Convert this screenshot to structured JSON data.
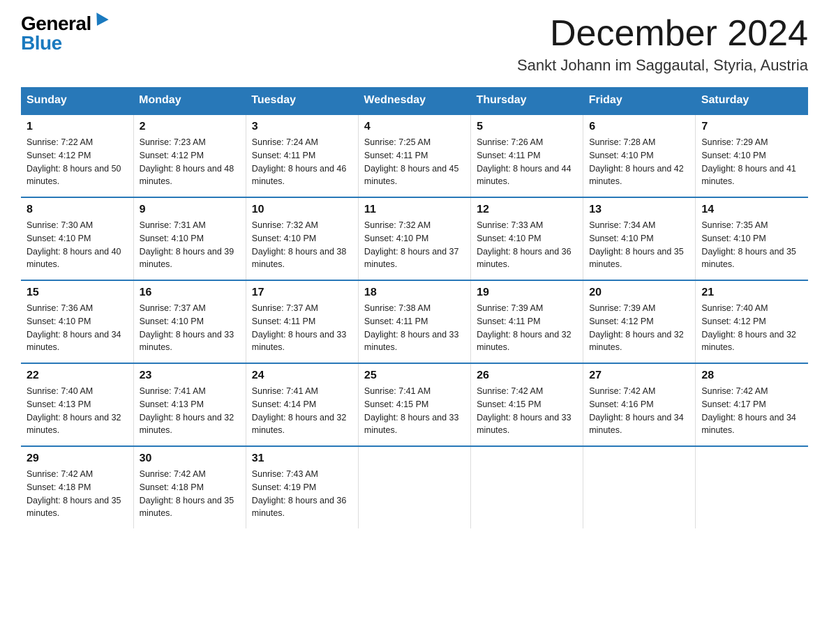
{
  "logo": {
    "general": "General",
    "blue": "Blue"
  },
  "header": {
    "month": "December 2024",
    "location": "Sankt Johann im Saggautal, Styria, Austria"
  },
  "weekdays": [
    "Sunday",
    "Monday",
    "Tuesday",
    "Wednesday",
    "Thursday",
    "Friday",
    "Saturday"
  ],
  "weeks": [
    [
      {
        "day": "1",
        "sunrise": "7:22 AM",
        "sunset": "4:12 PM",
        "daylight": "8 hours and 50 minutes."
      },
      {
        "day": "2",
        "sunrise": "7:23 AM",
        "sunset": "4:12 PM",
        "daylight": "8 hours and 48 minutes."
      },
      {
        "day": "3",
        "sunrise": "7:24 AM",
        "sunset": "4:11 PM",
        "daylight": "8 hours and 46 minutes."
      },
      {
        "day": "4",
        "sunrise": "7:25 AM",
        "sunset": "4:11 PM",
        "daylight": "8 hours and 45 minutes."
      },
      {
        "day": "5",
        "sunrise": "7:26 AM",
        "sunset": "4:11 PM",
        "daylight": "8 hours and 44 minutes."
      },
      {
        "day": "6",
        "sunrise": "7:28 AM",
        "sunset": "4:10 PM",
        "daylight": "8 hours and 42 minutes."
      },
      {
        "day": "7",
        "sunrise": "7:29 AM",
        "sunset": "4:10 PM",
        "daylight": "8 hours and 41 minutes."
      }
    ],
    [
      {
        "day": "8",
        "sunrise": "7:30 AM",
        "sunset": "4:10 PM",
        "daylight": "8 hours and 40 minutes."
      },
      {
        "day": "9",
        "sunrise": "7:31 AM",
        "sunset": "4:10 PM",
        "daylight": "8 hours and 39 minutes."
      },
      {
        "day": "10",
        "sunrise": "7:32 AM",
        "sunset": "4:10 PM",
        "daylight": "8 hours and 38 minutes."
      },
      {
        "day": "11",
        "sunrise": "7:32 AM",
        "sunset": "4:10 PM",
        "daylight": "8 hours and 37 minutes."
      },
      {
        "day": "12",
        "sunrise": "7:33 AM",
        "sunset": "4:10 PM",
        "daylight": "8 hours and 36 minutes."
      },
      {
        "day": "13",
        "sunrise": "7:34 AM",
        "sunset": "4:10 PM",
        "daylight": "8 hours and 35 minutes."
      },
      {
        "day": "14",
        "sunrise": "7:35 AM",
        "sunset": "4:10 PM",
        "daylight": "8 hours and 35 minutes."
      }
    ],
    [
      {
        "day": "15",
        "sunrise": "7:36 AM",
        "sunset": "4:10 PM",
        "daylight": "8 hours and 34 minutes."
      },
      {
        "day": "16",
        "sunrise": "7:37 AM",
        "sunset": "4:10 PM",
        "daylight": "8 hours and 33 minutes."
      },
      {
        "day": "17",
        "sunrise": "7:37 AM",
        "sunset": "4:11 PM",
        "daylight": "8 hours and 33 minutes."
      },
      {
        "day": "18",
        "sunrise": "7:38 AM",
        "sunset": "4:11 PM",
        "daylight": "8 hours and 33 minutes."
      },
      {
        "day": "19",
        "sunrise": "7:39 AM",
        "sunset": "4:11 PM",
        "daylight": "8 hours and 32 minutes."
      },
      {
        "day": "20",
        "sunrise": "7:39 AM",
        "sunset": "4:12 PM",
        "daylight": "8 hours and 32 minutes."
      },
      {
        "day": "21",
        "sunrise": "7:40 AM",
        "sunset": "4:12 PM",
        "daylight": "8 hours and 32 minutes."
      }
    ],
    [
      {
        "day": "22",
        "sunrise": "7:40 AM",
        "sunset": "4:13 PM",
        "daylight": "8 hours and 32 minutes."
      },
      {
        "day": "23",
        "sunrise": "7:41 AM",
        "sunset": "4:13 PM",
        "daylight": "8 hours and 32 minutes."
      },
      {
        "day": "24",
        "sunrise": "7:41 AM",
        "sunset": "4:14 PM",
        "daylight": "8 hours and 32 minutes."
      },
      {
        "day": "25",
        "sunrise": "7:41 AM",
        "sunset": "4:15 PM",
        "daylight": "8 hours and 33 minutes."
      },
      {
        "day": "26",
        "sunrise": "7:42 AM",
        "sunset": "4:15 PM",
        "daylight": "8 hours and 33 minutes."
      },
      {
        "day": "27",
        "sunrise": "7:42 AM",
        "sunset": "4:16 PM",
        "daylight": "8 hours and 34 minutes."
      },
      {
        "day": "28",
        "sunrise": "7:42 AM",
        "sunset": "4:17 PM",
        "daylight": "8 hours and 34 minutes."
      }
    ],
    [
      {
        "day": "29",
        "sunrise": "7:42 AM",
        "sunset": "4:18 PM",
        "daylight": "8 hours and 35 minutes."
      },
      {
        "day": "30",
        "sunrise": "7:42 AM",
        "sunset": "4:18 PM",
        "daylight": "8 hours and 35 minutes."
      },
      {
        "day": "31",
        "sunrise": "7:43 AM",
        "sunset": "4:19 PM",
        "daylight": "8 hours and 36 minutes."
      },
      null,
      null,
      null,
      null
    ]
  ],
  "labels": {
    "sunrise_prefix": "Sunrise: ",
    "sunset_prefix": "Sunset: ",
    "daylight_prefix": "Daylight: "
  }
}
